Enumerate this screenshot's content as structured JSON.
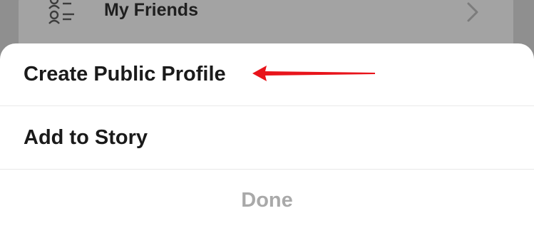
{
  "background_list": {
    "friends_row": {
      "label": "My Friends",
      "icon": "friends-list-icon",
      "chevron": "chevron-right-icon"
    }
  },
  "action_sheet": {
    "items": [
      {
        "label": "Create Public Profile"
      },
      {
        "label": "Add to Story"
      }
    ],
    "done_label": "Done"
  },
  "annotation": {
    "arrow": "red-arrow-icon",
    "arrow_color": "#e8141b"
  },
  "colors": {
    "sheet_background": "#ffffff",
    "backdrop": "#8f8f8f",
    "done_text": "#a9a9a9",
    "item_text": "#1a1a1a"
  }
}
